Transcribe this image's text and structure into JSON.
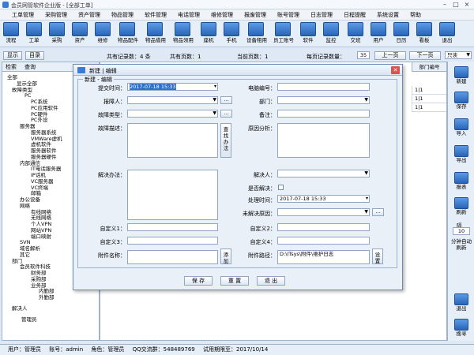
{
  "app": {
    "title": "会员网管软件企业版 - [全部工单]"
  },
  "menu": [
    "工单管理",
    "采购管理",
    "资产管理",
    "物品管理",
    "软件管理",
    "电话管理",
    "维修管理",
    "报废管理",
    "账号管理",
    "日志管理",
    "日程提醒",
    "系统设置",
    "帮助"
  ],
  "toolbar": [
    "流程",
    "工单",
    "采购",
    "资产",
    "维修",
    "物品配件",
    "物品借用",
    "物品领用",
    "座机",
    "手机",
    "设备租用",
    "员工账号",
    "软件",
    "监控",
    "交班",
    "用户",
    "日历",
    "看板",
    "退出"
  ],
  "nav": {
    "refresh": "显示",
    "export_btn": "目录",
    "total": "共有记录数：4 条",
    "pages": "共有页数：1",
    "current": "当前页数：1",
    "per_page_label": "每页记录数量：",
    "per_page_value": "35",
    "prev": "上一页",
    "next": "下一页",
    "filter": "只读"
  },
  "left_tabs": [
    "检索",
    "查询"
  ],
  "tree": [
    "全部",
    "显示全部",
    "故障类型",
    "PC",
    "PC系统",
    "PC应用软件",
    "PC硬件",
    "PC外设",
    "服务器",
    "服务器系统",
    "VMWare虚机",
    "虚机软件",
    "服务器软件",
    "服务器硬件",
    "内部通信",
    "IT电话服务器",
    "IP话机",
    "VC服务器",
    "VC终端",
    "邮箱",
    "办公设备",
    "网络",
    "有线网络",
    "无线网络",
    "个人VPN",
    "网站VPN",
    "端口映射",
    "SVN",
    "域名解析",
    "其它",
    "部门",
    "会员软件科技",
    "财务部",
    "采购部",
    "业务部",
    "内勤部",
    "外勤部",
    "解决人",
    "管理员"
  ],
  "grid": {
    "header": "部门编号",
    "rows": [
      "1|1",
      "1|1",
      "1|1"
    ]
  },
  "rightbar": [
    "新建",
    "保存",
    "导入",
    "导出",
    "报表",
    "刷新",
    "隔",
    "10",
    "分钟自动刷新",
    "退出",
    "搜寻"
  ],
  "status": {
    "user_label": "用户：",
    "user": "管理员",
    "account_label": "账号：",
    "account": "admin",
    "role_label": "角色：",
    "role": "管理员",
    "qq": "QQ交流群：548489769",
    "trial": "试用期限至：2017/10/14"
  },
  "dialog": {
    "title": "新建 | 编辑",
    "group": "新建 - 编辑",
    "left": {
      "submit_time_label": "提交时间：",
      "submit_time": "2017-07-18 15:33",
      "reporter_label": "报障人：",
      "fault_type_label": "故障类型：",
      "fault_desc_label": "故障描述：",
      "solution_label": "解决办法：",
      "custom1_label": "自定义1：",
      "custom3_label": "自定义3：",
      "attach_name_label": "附件名称：",
      "query_btn": "查找办法",
      "add_btn": "添加"
    },
    "right": {
      "pc_no_label": "电脑编号：",
      "dept_label": "部门：",
      "note_label": "备注：",
      "cause_label": "原因分析：",
      "resolver_label": "解决人：",
      "resolved_label": "是否解决：",
      "process_time_label": "处理时间：",
      "process_time": "2017-07-18 15:33",
      "unresolved_label": "未解决原因：",
      "custom2_label": "自定义2：",
      "custom4_label": "自定义4：",
      "attach_path_label": "附件路径：",
      "attach_path": "D:\\ITsys\\附件\\维护日志",
      "open_btn": "设置"
    },
    "buttons": [
      "保 存",
      "重 置",
      "退 出"
    ]
  },
  "colors": {
    "accent": "#2f6fc9",
    "icon": "#3a7bd5",
    "bg": "#dfe9f5",
    "close": "#d9534f"
  }
}
